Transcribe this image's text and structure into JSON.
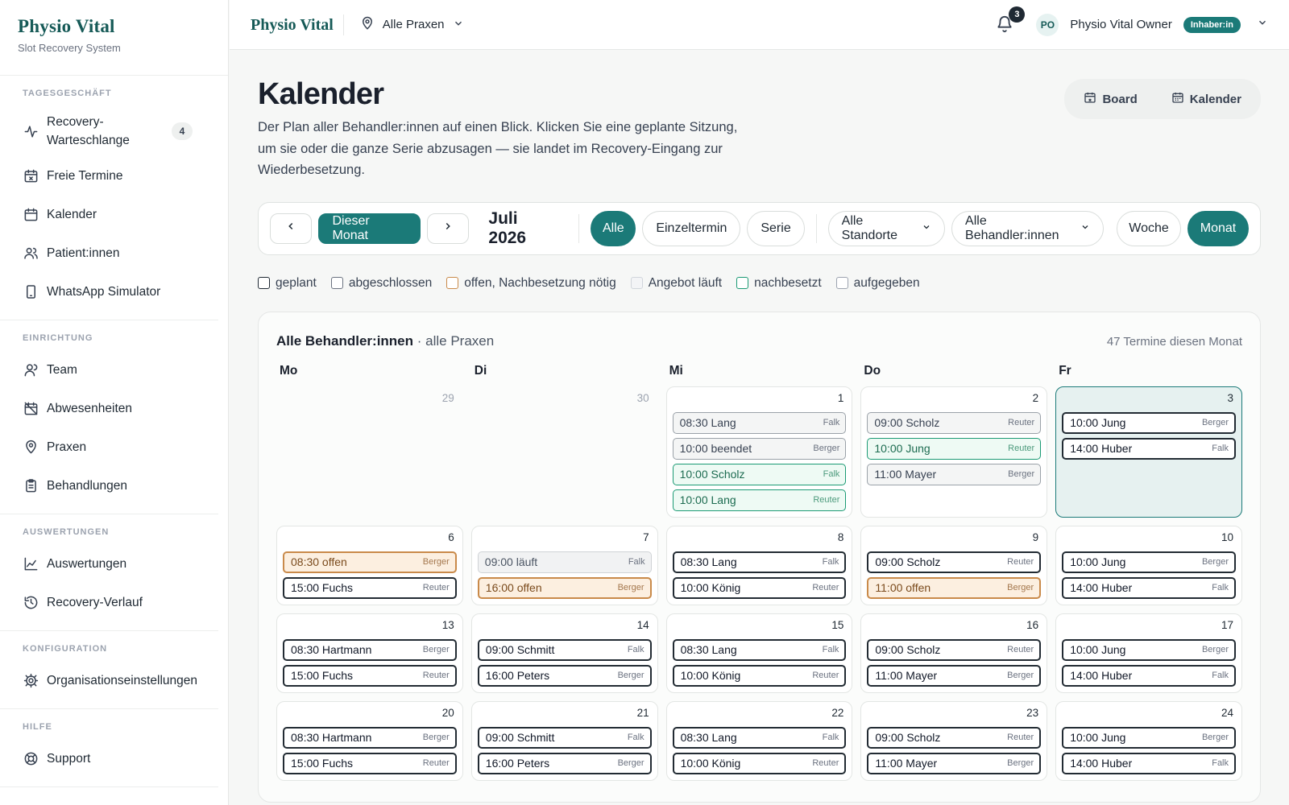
{
  "brand": {
    "name": "Physio Vital",
    "subtitle": "Slot Recovery System"
  },
  "sidebar": {
    "sections": [
      {
        "title": "Tagesgeschäft",
        "items": [
          {
            "label": "Recovery-Warteschlange",
            "icon": "activity-icon",
            "badge": "4"
          },
          {
            "label": "Freie Termine",
            "icon": "calendar-x-icon"
          },
          {
            "label": "Kalender",
            "icon": "calendar-icon"
          },
          {
            "label": "Patient:innen",
            "icon": "users-icon"
          },
          {
            "label": "WhatsApp Simulator",
            "icon": "phone-icon"
          }
        ]
      },
      {
        "title": "Einrichtung",
        "items": [
          {
            "label": "Team",
            "icon": "team-icon"
          },
          {
            "label": "Abwesenheiten",
            "icon": "calendar-off-icon"
          },
          {
            "label": "Praxen",
            "icon": "map-pin-icon"
          },
          {
            "label": "Behandlungen",
            "icon": "clipboard-icon"
          }
        ]
      },
      {
        "title": "Auswertungen",
        "items": [
          {
            "label": "Auswertungen",
            "icon": "line-chart-icon"
          },
          {
            "label": "Recovery-Verlauf",
            "icon": "history-icon"
          }
        ]
      },
      {
        "title": "Konfiguration",
        "items": [
          {
            "label": "Organisationseinstellungen",
            "icon": "gear-icon"
          }
        ]
      },
      {
        "title": "Hilfe",
        "items": [
          {
            "label": "Support",
            "icon": "lifebuoy-icon"
          }
        ]
      }
    ]
  },
  "topbar": {
    "brand": "Physio Vital",
    "location": "Alle Praxen",
    "notifications": "3",
    "avatar": "PO",
    "user": "Physio Vital Owner",
    "role": "Inhaber:in"
  },
  "page": {
    "title": "Kalender",
    "description": "Der Plan aller Behandler:innen auf einen Blick. Klicken Sie eine geplante Sitzung, um sie oder die ganze Serie abzusagen — sie landet im Recovery-Eingang zur Wiederbesetzung.",
    "view_switch": {
      "board": "Board",
      "calendar": "Kalender"
    }
  },
  "toolbar": {
    "prev": "‹",
    "today": "Dieser Monat",
    "next": "›",
    "month": "Juli 2026",
    "type_filters": [
      "Alle",
      "Einzeltermin",
      "Serie"
    ],
    "location": "Alle Standorte",
    "therapist": "Alle Behandler:innen",
    "views": [
      "Woche",
      "Monat"
    ]
  },
  "legend": [
    {
      "label": "geplant",
      "color": "#1f2933",
      "fill": "#ffffff"
    },
    {
      "label": "abgeschlossen",
      "color": "#6b7280",
      "fill": "#ffffff"
    },
    {
      "label": "offen, Nachbesetzung nötig",
      "color": "#c98a4a",
      "fill": "#ffffff"
    },
    {
      "label": "Angebot läuft",
      "color": "#d1d5db",
      "fill": "#f3f4f6"
    },
    {
      "label": "nachbesetzt",
      "color": "#1b9a74",
      "fill": "#ffffff"
    },
    {
      "label": "aufgegeben",
      "color": "#9ca3af",
      "fill": "#ffffff"
    }
  ],
  "calendar": {
    "title": "Alle Behandler:innen",
    "subtitle": " · alle Praxen",
    "count": "47 Termine diesen Monat",
    "weekdays": [
      "Mo",
      "Di",
      "Mi",
      "Do",
      "Fr"
    ],
    "weeks": [
      [
        {
          "day": "29",
          "empty": true,
          "appts": []
        },
        {
          "day": "30",
          "empty": true,
          "appts": []
        },
        {
          "day": "1",
          "appts": [
            {
              "text": "08:30 Lang",
              "who": "Falk",
              "status": "done"
            },
            {
              "text": "10:00 beendet",
              "who": "Berger",
              "status": "done"
            },
            {
              "text": "10:00 Scholz",
              "who": "Falk",
              "status": "filled"
            },
            {
              "text": "10:00 Lang",
              "who": "Reuter",
              "status": "filled"
            }
          ]
        },
        {
          "day": "2",
          "appts": [
            {
              "text": "09:00 Scholz",
              "who": "Reuter",
              "status": "done"
            },
            {
              "text": "10:00 Jung",
              "who": "Reuter",
              "status": "filled"
            },
            {
              "text": "11:00 Mayer",
              "who": "Berger",
              "status": "done"
            }
          ]
        },
        {
          "day": "3",
          "today": true,
          "appts": [
            {
              "text": "10:00 Jung",
              "who": "Berger",
              "status": "planned"
            },
            {
              "text": "14:00 Huber",
              "who": "Falk",
              "status": "planned"
            }
          ]
        }
      ],
      [
        {
          "day": "6",
          "appts": [
            {
              "text": "08:30 offen",
              "who": "Berger",
              "status": "open"
            },
            {
              "text": "15:00 Fuchs",
              "who": "Reuter",
              "status": "planned"
            }
          ]
        },
        {
          "day": "7",
          "appts": [
            {
              "text": "09:00 läuft",
              "who": "Falk",
              "status": "running"
            },
            {
              "text": "16:00 offen",
              "who": "Berger",
              "status": "open"
            }
          ]
        },
        {
          "day": "8",
          "appts": [
            {
              "text": "08:30 Lang",
              "who": "Falk",
              "status": "planned"
            },
            {
              "text": "10:00 König",
              "who": "Reuter",
              "status": "planned"
            }
          ]
        },
        {
          "day": "9",
          "appts": [
            {
              "text": "09:00 Scholz",
              "who": "Reuter",
              "status": "planned"
            },
            {
              "text": "11:00 offen",
              "who": "Berger",
              "status": "open"
            }
          ]
        },
        {
          "day": "10",
          "appts": [
            {
              "text": "10:00 Jung",
              "who": "Berger",
              "status": "planned"
            },
            {
              "text": "14:00 Huber",
              "who": "Falk",
              "status": "planned"
            }
          ]
        }
      ],
      [
        {
          "day": "13",
          "appts": [
            {
              "text": "08:30 Hartmann",
              "who": "Berger",
              "status": "planned"
            },
            {
              "text": "15:00 Fuchs",
              "who": "Reuter",
              "status": "planned"
            }
          ]
        },
        {
          "day": "14",
          "appts": [
            {
              "text": "09:00 Schmitt",
              "who": "Falk",
              "status": "planned"
            },
            {
              "text": "16:00 Peters",
              "who": "Berger",
              "status": "planned"
            }
          ]
        },
        {
          "day": "15",
          "appts": [
            {
              "text": "08:30 Lang",
              "who": "Falk",
              "status": "planned"
            },
            {
              "text": "10:00 König",
              "who": "Reuter",
              "status": "planned"
            }
          ]
        },
        {
          "day": "16",
          "appts": [
            {
              "text": "09:00 Scholz",
              "who": "Reuter",
              "status": "planned"
            },
            {
              "text": "11:00 Mayer",
              "who": "Berger",
              "status": "planned"
            }
          ]
        },
        {
          "day": "17",
          "appts": [
            {
              "text": "10:00 Jung",
              "who": "Berger",
              "status": "planned"
            },
            {
              "text": "14:00 Huber",
              "who": "Falk",
              "status": "planned"
            }
          ]
        }
      ],
      [
        {
          "day": "20",
          "appts": [
            {
              "text": "08:30 Hartmann",
              "who": "Berger",
              "status": "planned"
            },
            {
              "text": "15:00 Fuchs",
              "who": "Reuter",
              "status": "planned"
            }
          ]
        },
        {
          "day": "21",
          "appts": [
            {
              "text": "09:00 Schmitt",
              "who": "Falk",
              "status": "planned"
            },
            {
              "text": "16:00 Peters",
              "who": "Berger",
              "status": "planned"
            }
          ]
        },
        {
          "day": "22",
          "appts": [
            {
              "text": "08:30 Lang",
              "who": "Falk",
              "status": "planned"
            },
            {
              "text": "10:00 König",
              "who": "Reuter",
              "status": "planned"
            }
          ]
        },
        {
          "day": "23",
          "appts": [
            {
              "text": "09:00 Scholz",
              "who": "Reuter",
              "status": "planned"
            },
            {
              "text": "11:00 Mayer",
              "who": "Berger",
              "status": "planned"
            }
          ]
        },
        {
          "day": "24",
          "appts": [
            {
              "text": "10:00 Jung",
              "who": "Berger",
              "status": "planned"
            },
            {
              "text": "14:00 Huber",
              "who": "Falk",
              "status": "planned"
            }
          ]
        }
      ]
    ]
  },
  "colors": {
    "brand": "#165a57",
    "accent": "#1b7a78",
    "open": "#c98a4a",
    "filled": "#1b9a74"
  }
}
